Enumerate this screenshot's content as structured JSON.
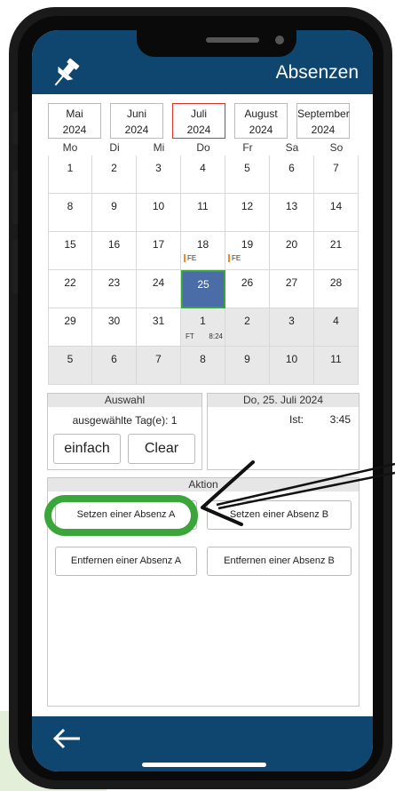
{
  "header": {
    "title": "Absenzen",
    "pin_icon": "pin-icon"
  },
  "months": [
    {
      "name": "Mai",
      "year": "2024",
      "selected": false
    },
    {
      "name": "Juni",
      "year": "2024",
      "selected": false
    },
    {
      "name": "Juli",
      "year": "2024",
      "selected": true
    },
    {
      "name": "August",
      "year": "2024",
      "selected": false
    },
    {
      "name": "September",
      "year": "2024",
      "selected": false
    }
  ],
  "weekdays": [
    "Mo",
    "Di",
    "Mi",
    "Do",
    "Fr",
    "Sa",
    "So"
  ],
  "weeks": [
    [
      {
        "d": "1"
      },
      {
        "d": "2"
      },
      {
        "d": "3"
      },
      {
        "d": "4"
      },
      {
        "d": "5"
      },
      {
        "d": "6"
      },
      {
        "d": "7"
      }
    ],
    [
      {
        "d": "8"
      },
      {
        "d": "9"
      },
      {
        "d": "10"
      },
      {
        "d": "11"
      },
      {
        "d": "12"
      },
      {
        "d": "13"
      },
      {
        "d": "14"
      }
    ],
    [
      {
        "d": "15"
      },
      {
        "d": "16"
      },
      {
        "d": "17"
      },
      {
        "d": "18",
        "tag": "FE"
      },
      {
        "d": "19",
        "tag": "FE"
      },
      {
        "d": "20"
      },
      {
        "d": "21"
      }
    ],
    [
      {
        "d": "22"
      },
      {
        "d": "23"
      },
      {
        "d": "24"
      },
      {
        "d": "25",
        "selected": true
      },
      {
        "d": "26"
      },
      {
        "d": "27"
      },
      {
        "d": "28"
      }
    ],
    [
      {
        "d": "29"
      },
      {
        "d": "30"
      },
      {
        "d": "31"
      },
      {
        "d": "1",
        "grey": true,
        "ft": "FT",
        "time": "8:24"
      },
      {
        "d": "2",
        "grey": true
      },
      {
        "d": "3",
        "grey": true
      },
      {
        "d": "4",
        "grey": true
      }
    ],
    [
      {
        "d": "5",
        "grey": true
      },
      {
        "d": "6",
        "grey": true
      },
      {
        "d": "7",
        "grey": true
      },
      {
        "d": "8",
        "grey": true
      },
      {
        "d": "9",
        "grey": true
      },
      {
        "d": "10",
        "grey": true
      },
      {
        "d": "11",
        "grey": true
      }
    ]
  ],
  "auswahl": {
    "title": "Auswahl",
    "selected_days": "ausgewählte Tag(e): 1",
    "einfach": "einfach",
    "clear": "Clear"
  },
  "day_panel": {
    "title": "Do, 25. Juli 2024",
    "ist_label": "Ist:",
    "ist_value": "3:45"
  },
  "aktion": {
    "title": "Aktion",
    "set_a": "Setzen einer Absenz A",
    "set_b": "Setzen einer Absenz B",
    "remove_a": "Entfernen einer Absenz A",
    "remove_b": "Entfernen einer Absenz B"
  },
  "footer": {
    "back_icon": "back-arrow-icon"
  },
  "colors": {
    "brand": "#0e4670",
    "selected_day": "#4a6da8",
    "highlight": "#3aa63a",
    "tag": "#f08a2c"
  }
}
